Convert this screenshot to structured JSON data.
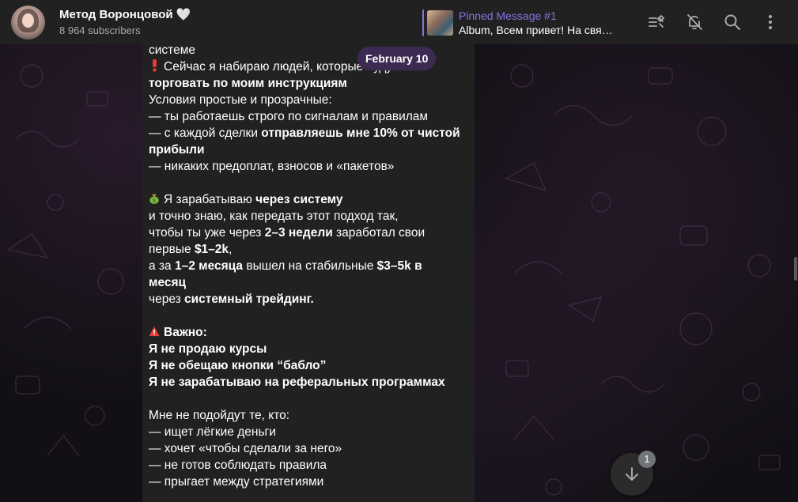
{
  "header": {
    "channel_title": "Метод Воронцовой 🤍",
    "subscribers": "8 964 subscribers",
    "pinned_title": "Pinned Message #1",
    "pinned_text": "Album, Всем привет! На связ…",
    "icons": [
      "pinned-list-icon",
      "mute-icon",
      "search-icon",
      "more-icon"
    ]
  },
  "date_pill": "February 10",
  "message": {
    "l0": "системе",
    "l1_a": "Сейчас я набираю людей, которые будут",
    "l2": "торговать по моим инструкциям",
    "l3": "Условия простые и прозрачные:",
    "l4": "— ты работаешь строго по сигналам и правилам",
    "l5_a": "— с каждой сделки ",
    "l5_b": "отправляешь мне 10% от чистой",
    "l6": "прибыли",
    "l7": "— никаких предоплат, взносов и «пакетов»",
    "l9_a": "Я зарабатываю ",
    "l9_b": "через систему",
    "l10": "и точно знаю, как передать этот подход так,",
    "l11_a": "чтобы ты уже через ",
    "l11_b": "2–3 недели",
    "l11_c": " заработал свои",
    "l12_a": "первые ",
    "l12_b": "$1–2k",
    "l12_c": ",",
    "l13_a": "а за ",
    "l13_b": "1–2 месяца",
    "l13_c": " вышел на стабильные ",
    "l13_d": "$3–5k в",
    "l14": "месяц",
    "l15_a": "через ",
    "l15_b": "системный трейдинг.",
    "l17": "Важно:",
    "l18": "Я не продаю курсы",
    "l19": "Я не обещаю кнопки “бабло”",
    "l20": "Я не зарабатываю на реферальных программах",
    "l22": "Мне не подойдут те, кто:",
    "l23": "— ищет лёгкие деньги",
    "l24": "— хочет «чтобы сделали за него»",
    "l25": "— не готов соблюдать правила",
    "l26": "— прыгает между стратегиями"
  },
  "scroll_badge": "1",
  "colors": {
    "accent": "#8774e1",
    "header_bg": "#212121",
    "bubble_bg": "#212121",
    "date_pill_bg": "#3c2a52"
  }
}
